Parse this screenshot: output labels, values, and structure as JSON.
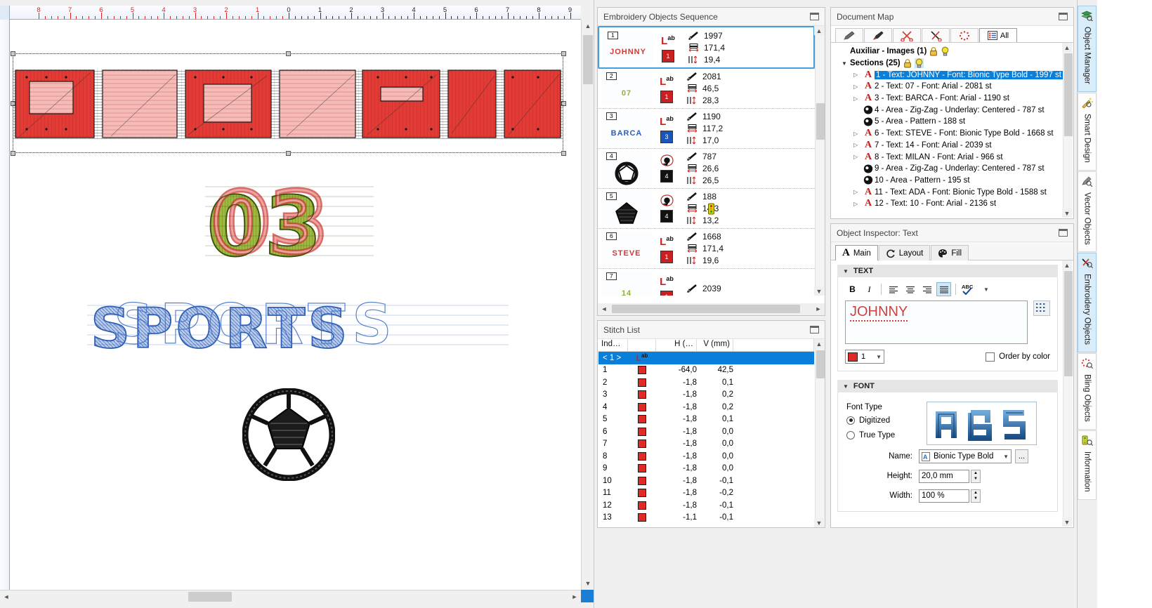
{
  "canvas": {
    "ruler_labels_left": [
      "8",
      "7",
      "6",
      "5",
      "4",
      "3",
      "2",
      "1"
    ],
    "ruler_zero": "0",
    "ruler_labels_right": [
      "1",
      "2",
      "3",
      "4",
      "5",
      "6",
      "7",
      "8",
      "9"
    ],
    "artwork": [
      {
        "name": "johnny-text",
        "text": "JOHNNY",
        "color": "#e23b36"
      },
      {
        "name": "number-03",
        "text": "03",
        "color": "#8fb13a"
      },
      {
        "name": "sports-text",
        "text": "SPORTS",
        "color": "#2f5fb5"
      },
      {
        "name": "soccer-ball",
        "text": "",
        "color": "#111111"
      }
    ]
  },
  "objects_sequence": {
    "title": "Embroidery Objects Sequence",
    "rows": [
      {
        "num": "1",
        "preview": "JOHNNY",
        "preview_color": "#cf3a34",
        "type": "text",
        "color_index": "1",
        "color": "#cc1f20",
        "stitches": "1997",
        "width": "171,4",
        "height": "19,4",
        "warn": false
      },
      {
        "num": "2",
        "preview": "07",
        "preview_color": "#8fb13a",
        "type": "text",
        "color_index": "1",
        "color": "#cc1f20",
        "stitches": "2081",
        "width": "46,5",
        "height": "28,3",
        "warn": false
      },
      {
        "num": "3",
        "preview": "BARCA",
        "preview_color": "#2f5fb5",
        "type": "text",
        "color_index": "3",
        "color": "#1a55bb",
        "stitches": "1190",
        "width": "117,2",
        "height": "17,0",
        "warn": false
      },
      {
        "num": "4",
        "preview": "ring",
        "preview_color": "#111111",
        "type": "area",
        "color_index": "4",
        "color": "#111111",
        "stitches": "787",
        "width": "26,6",
        "height": "26,5",
        "warn": false
      },
      {
        "num": "5",
        "preview": "star",
        "preview_color": "#111111",
        "type": "area",
        "color_index": "4",
        "color": "#111111",
        "stitches": "188",
        "width": "14,3",
        "height": "13,2",
        "warn": true
      },
      {
        "num": "6",
        "preview": "STEVE",
        "preview_color": "#cf3a34",
        "type": "text",
        "color_index": "1",
        "color": "#cc1f20",
        "stitches": "1668",
        "width": "171,4",
        "height": "19,6",
        "warn": false
      },
      {
        "num": "7",
        "preview": "14",
        "preview_color": "#8fb13a",
        "type": "text",
        "color_index": "1",
        "color": "#cc1f20",
        "stitches": "2039",
        "width": "",
        "height": "",
        "warn": false
      }
    ]
  },
  "stitch_list": {
    "title": "Stitch List",
    "columns": [
      "Ind…",
      "",
      "H (…",
      "V (mm)"
    ],
    "group_row": "< 1 >",
    "rows": [
      {
        "index": "1",
        "color": "#e02a26",
        "h": "-64,0",
        "v": "42,5"
      },
      {
        "index": "2",
        "color": "#e02a26",
        "h": "-1,8",
        "v": "0,1"
      },
      {
        "index": "3",
        "color": "#e02a26",
        "h": "-1,8",
        "v": "0,2"
      },
      {
        "index": "4",
        "color": "#e02a26",
        "h": "-1,8",
        "v": "0,2"
      },
      {
        "index": "5",
        "color": "#e02a26",
        "h": "-1,8",
        "v": "0,1"
      },
      {
        "index": "6",
        "color": "#e02a26",
        "h": "-1,8",
        "v": "0,0"
      },
      {
        "index": "7",
        "color": "#e02a26",
        "h": "-1,8",
        "v": "0,0"
      },
      {
        "index": "8",
        "color": "#e02a26",
        "h": "-1,8",
        "v": "0,0"
      },
      {
        "index": "9",
        "color": "#e02a26",
        "h": "-1,8",
        "v": "0,0"
      },
      {
        "index": "10",
        "color": "#e02a26",
        "h": "-1,8",
        "v": "-0,1"
      },
      {
        "index": "11",
        "color": "#e02a26",
        "h": "-1,8",
        "v": "-0,2"
      },
      {
        "index": "12",
        "color": "#e02a26",
        "h": "-1,8",
        "v": "-0,1"
      },
      {
        "index": "13",
        "color": "#e02a26",
        "h": "-1,1",
        "v": "-0,1"
      }
    ]
  },
  "document_map": {
    "title": "Document Map",
    "tabs": [
      {
        "name": "pencil-icon",
        "label": ""
      },
      {
        "name": "brush-icon",
        "label": ""
      },
      {
        "name": "scissors-icon",
        "label": ""
      },
      {
        "name": "cut-curve-icon",
        "label": ""
      },
      {
        "name": "bling-icon",
        "label": ""
      },
      {
        "name": "all-list-icon",
        "label": "All"
      }
    ],
    "tree": [
      {
        "level": 0,
        "caret": "",
        "icon": "none",
        "label": "Auxiliar - Images (1)",
        "bold": true,
        "lock": true,
        "bulb": true,
        "selected": false
      },
      {
        "level": 0,
        "caret": "open",
        "icon": "none",
        "label": "Sections (25)",
        "bold": true,
        "lock": true,
        "bulb": true,
        "selected": false
      },
      {
        "level": 1,
        "caret": "closed",
        "icon": "text",
        "label": "1 - Text: JOHNNY - Font: Bionic Type Bold - 1997 st",
        "bold": false,
        "selected": true
      },
      {
        "level": 1,
        "caret": "closed",
        "icon": "text",
        "label": "2 - Text: 07 - Font: Arial - 2081 st",
        "bold": false,
        "selected": false
      },
      {
        "level": 1,
        "caret": "closed",
        "icon": "text",
        "label": "3 - Text: BARCA - Font: Arial - 1190 st",
        "bold": false,
        "selected": false
      },
      {
        "level": 1,
        "caret": "",
        "icon": "area",
        "label": "4 - Area - Zig-Zag - Underlay: Centered - 787 st",
        "bold": false,
        "selected": false
      },
      {
        "level": 1,
        "caret": "",
        "icon": "area",
        "label": "5 - Area - Pattern - 188 st",
        "bold": false,
        "selected": false
      },
      {
        "level": 1,
        "caret": "closed",
        "icon": "text",
        "label": "6 - Text: STEVE - Font: Bionic Type Bold - 1668 st",
        "bold": false,
        "selected": false
      },
      {
        "level": 1,
        "caret": "closed",
        "icon": "text",
        "label": "7 - Text: 14 - Font: Arial - 2039 st",
        "bold": false,
        "selected": false
      },
      {
        "level": 1,
        "caret": "closed",
        "icon": "text",
        "label": "8 - Text: MILAN - Font: Arial - 966 st",
        "bold": false,
        "selected": false
      },
      {
        "level": 1,
        "caret": "",
        "icon": "area",
        "label": "9 - Area - Zig-Zag - Underlay: Centered - 787 st",
        "bold": false,
        "selected": false
      },
      {
        "level": 1,
        "caret": "",
        "icon": "area",
        "label": "10 - Area - Pattern - 195 st",
        "bold": false,
        "selected": false
      },
      {
        "level": 1,
        "caret": "closed",
        "icon": "text",
        "label": "11 - Text: ADA - Font: Bionic Type Bold - 1588 st",
        "bold": false,
        "selected": false
      },
      {
        "level": 1,
        "caret": "closed",
        "icon": "text",
        "label": "12 - Text: 10 - Font: Arial - 2136 st",
        "bold": false,
        "selected": false
      }
    ]
  },
  "inspector": {
    "title": "Object Inspector: Text",
    "tabs": [
      {
        "label": "Main",
        "icon": "letter-a-icon",
        "active": true
      },
      {
        "label": "Layout",
        "icon": "rotate-icon",
        "active": false
      },
      {
        "label": "Fill",
        "icon": "palette-icon",
        "active": false
      }
    ],
    "text_group": {
      "heading": "TEXT",
      "bold_label": "B",
      "italic_label": "I",
      "align_left": "left-align-icon",
      "align_center": "center-align-icon",
      "align_right": "right-align-icon",
      "align_justify": "justify-icon",
      "spell_label": "ABC",
      "value": "JOHNNY",
      "color_index": "1",
      "color": "#e02a26",
      "order_by_color_label": "Order by color",
      "order_by_color_checked": false
    },
    "font_group": {
      "heading": "FONT",
      "font_type_label": "Font Type",
      "digitized_label": "Digitized",
      "digitized_selected": true,
      "truetype_label": "True Type",
      "preview_text": "ABS",
      "name_label": "Name:",
      "name_value": "Bionic Type Bold",
      "ellipsis_label": "...",
      "height_label": "Height:",
      "height_value": "20,0 mm",
      "width_label": "Width:",
      "width_value": "100 %"
    }
  },
  "vertical_tabs": [
    {
      "label": "Object Manager",
      "icon": "layers-search-icon",
      "active": true
    },
    {
      "label": "Smart Design",
      "icon": "magic-wand-icon",
      "active": false
    },
    {
      "label": "Vector Objects",
      "icon": "pencil-search-icon",
      "active": false
    },
    {
      "label": "Embroidery Objects",
      "icon": "needle-search-icon",
      "active": true
    },
    {
      "label": "Bling Objects",
      "icon": "sparkle-search-icon",
      "active": false
    },
    {
      "label": "Information",
      "icon": "info-search-icon",
      "active": false
    }
  ]
}
